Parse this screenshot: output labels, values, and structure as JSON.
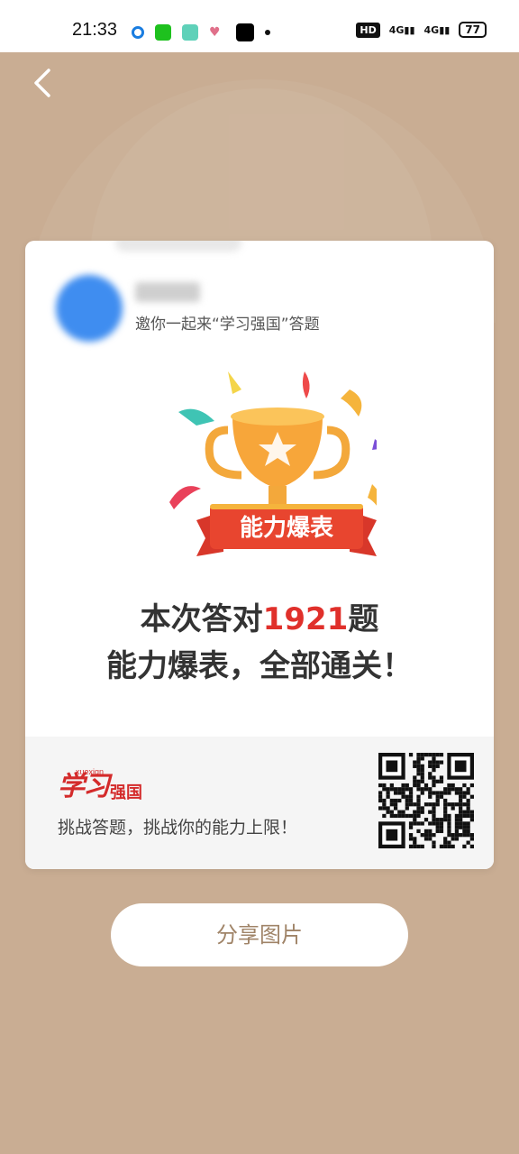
{
  "status_bar": {
    "time": "21:33",
    "hd_label": "HD",
    "signal_1": "4G",
    "signal_2": "4G",
    "battery": "77"
  },
  "nav": {
    "back_icon": "chevron-left-icon"
  },
  "card": {
    "invite_text": "邀你一起来“学习强国”答题",
    "badge_text": "能力爆表",
    "headline_prefix": "本次答对",
    "headline_count": "1921",
    "headline_suffix": "题",
    "headline_line2": "能力爆表，全部通关！",
    "footer": {
      "logo_script": "学习",
      "logo_cn": "强国",
      "logo_pinyin": "xuexiqn",
      "slogan": "挑战答题，挑战你的能力上限！"
    }
  },
  "share_button": {
    "label": "分享图片"
  },
  "colors": {
    "background": "#c9ad93",
    "accent_red": "#e0302b",
    "button_text": "#a08468"
  }
}
